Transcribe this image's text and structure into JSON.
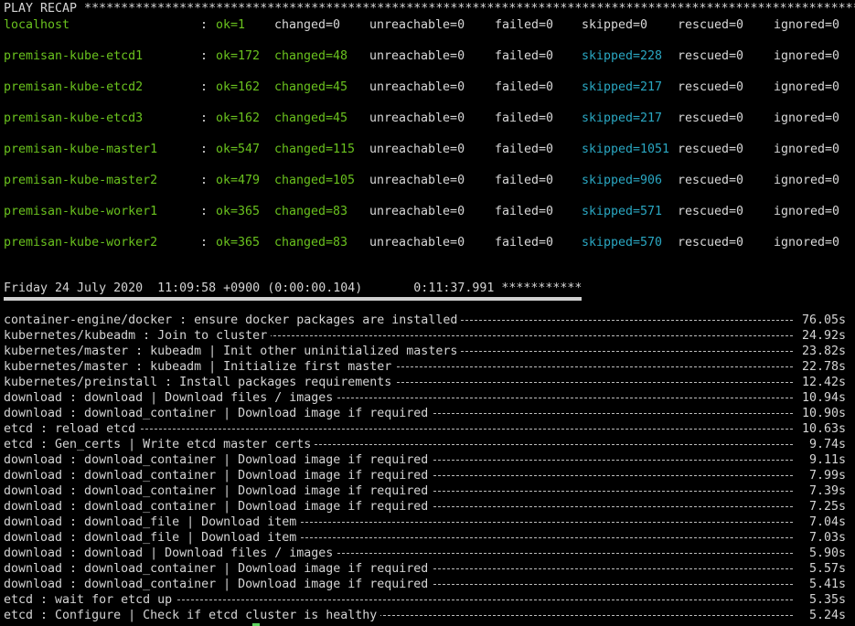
{
  "recap_header": "PLAY RECAP *************************************************************************************************************************",
  "recap": [
    {
      "host": "localhost",
      "ok": "ok=1",
      "changed": "changed=0",
      "unreachable": "unreachable=0",
      "failed": "failed=0",
      "skipped": "skipped=0",
      "rescued": "rescued=0",
      "ignored": "ignored=0"
    },
    {
      "host": "premisan-kube-etcd1",
      "ok": "ok=172",
      "changed": "changed=48",
      "unreachable": "unreachable=0",
      "failed": "failed=0",
      "skipped": "skipped=228",
      "rescued": "rescued=0",
      "ignored": "ignored=0"
    },
    {
      "host": "premisan-kube-etcd2",
      "ok": "ok=162",
      "changed": "changed=45",
      "unreachable": "unreachable=0",
      "failed": "failed=0",
      "skipped": "skipped=217",
      "rescued": "rescued=0",
      "ignored": "ignored=0"
    },
    {
      "host": "premisan-kube-etcd3",
      "ok": "ok=162",
      "changed": "changed=45",
      "unreachable": "unreachable=0",
      "failed": "failed=0",
      "skipped": "skipped=217",
      "rescued": "rescued=0",
      "ignored": "ignored=0"
    },
    {
      "host": "premisan-kube-master1",
      "ok": "ok=547",
      "changed": "changed=115",
      "unreachable": "unreachable=0",
      "failed": "failed=0",
      "skipped": "skipped=1051",
      "rescued": "rescued=0",
      "ignored": "ignored=0"
    },
    {
      "host": "premisan-kube-master2",
      "ok": "ok=479",
      "changed": "changed=105",
      "unreachable": "unreachable=0",
      "failed": "failed=0",
      "skipped": "skipped=906",
      "rescued": "rescued=0",
      "ignored": "ignored=0"
    },
    {
      "host": "premisan-kube-worker1",
      "ok": "ok=365",
      "changed": "changed=83",
      "unreachable": "unreachable=0",
      "failed": "failed=0",
      "skipped": "skipped=571",
      "rescued": "rescued=0",
      "ignored": "ignored=0"
    },
    {
      "host": "premisan-kube-worker2",
      "ok": "ok=365",
      "changed": "changed=83",
      "unreachable": "unreachable=0",
      "failed": "failed=0",
      "skipped": "skipped=570",
      "rescued": "rescued=0",
      "ignored": "ignored=0"
    }
  ],
  "colon": ":",
  "timestamp_line": "Friday 24 July 2020  11:09:58 +0900 (0:00:00.104)       0:11:37.991 ***********",
  "tasks": [
    {
      "name": "container-engine/docker : ensure docker packages are installed",
      "time": "76.05s"
    },
    {
      "name": "kubernetes/kubeadm : Join to cluster",
      "time": "24.92s"
    },
    {
      "name": "kubernetes/master : kubeadm | Init other uninitialized masters",
      "time": "23.82s"
    },
    {
      "name": "kubernetes/master : kubeadm | Initialize first master",
      "time": "22.78s"
    },
    {
      "name": "kubernetes/preinstall : Install packages requirements",
      "time": "12.42s"
    },
    {
      "name": "download : download | Download files / images",
      "time": "10.94s"
    },
    {
      "name": "download : download_container | Download image if required",
      "time": "10.90s"
    },
    {
      "name": "etcd : reload etcd",
      "time": "10.63s"
    },
    {
      "name": "etcd : Gen_certs | Write etcd master certs",
      "time": "9.74s"
    },
    {
      "name": "download : download_container | Download image if required",
      "time": "9.11s"
    },
    {
      "name": "download : download_container | Download image if required",
      "time": "7.99s"
    },
    {
      "name": "download : download_container | Download image if required",
      "time": "7.39s"
    },
    {
      "name": "download : download_container | Download image if required",
      "time": "7.25s"
    },
    {
      "name": "download : download_file | Download item",
      "time": "7.04s"
    },
    {
      "name": "download : download_file | Download item",
      "time": "7.03s"
    },
    {
      "name": "download : download | Download files / images",
      "time": "5.90s"
    },
    {
      "name": "download : download_container | Download image if required",
      "time": "5.57s"
    },
    {
      "name": "download : download_container | Download image if required",
      "time": "5.41s"
    },
    {
      "name": "etcd : wait for etcd up",
      "time": "5.35s"
    },
    {
      "name": "etcd : Configure | Check if etcd cluster is healthy",
      "time": "5.24s"
    }
  ],
  "colors": {
    "background": "#000000",
    "ok_green": "#6ac21e",
    "skipped_cyan": "#2aa7c2",
    "text": "#d4d4d4",
    "cursor": "#5fd35f"
  }
}
